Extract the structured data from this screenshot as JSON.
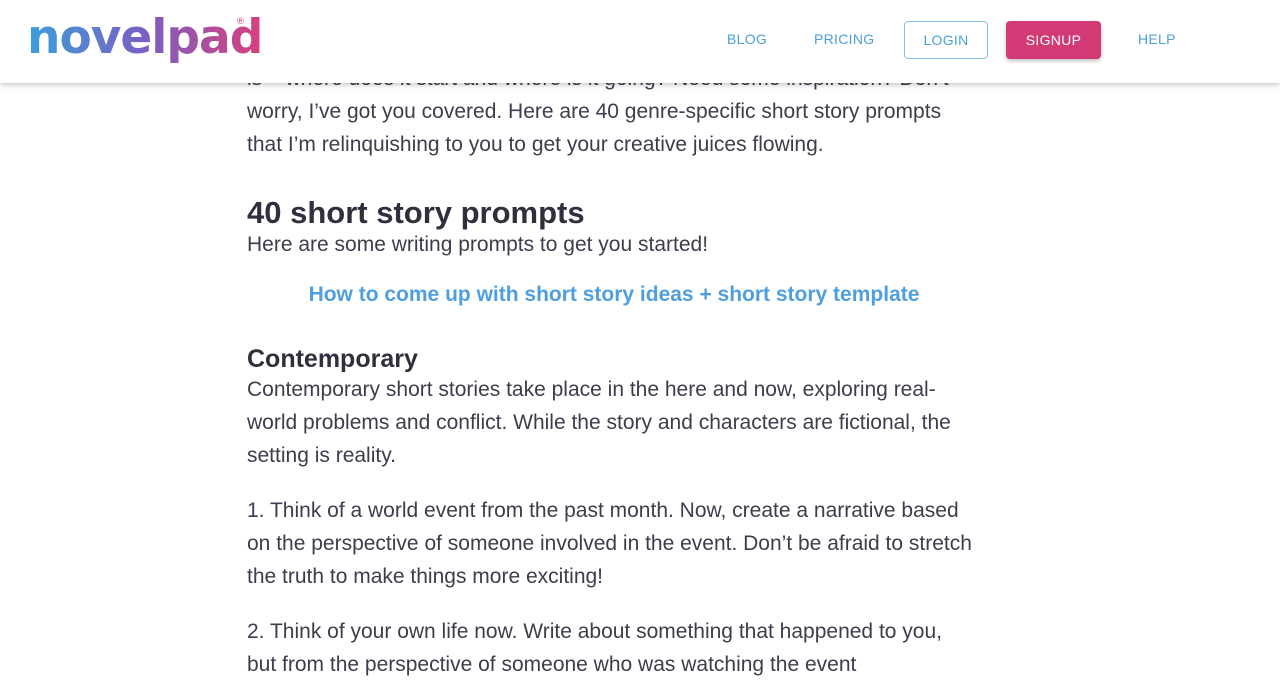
{
  "header": {
    "logo_text": "novelpad",
    "logo_mark": "®",
    "nav": {
      "blog": "BLOG",
      "pricing": "PRICING",
      "login": "LOGIN",
      "signup": "SIGNUP",
      "help": "HELP"
    },
    "colors": {
      "link": "#4a9fd8",
      "signup_bg": "#d23a76",
      "logo_gradient": [
        "#3aa0dc",
        "#7b5fc2",
        "#d8407c"
      ]
    }
  },
  "article": {
    "intro_partial_line": "is – where does it start and where is it going? Need some inspiration? Don’t",
    "intro_rest": "worry, I’ve got you covered. Here are 40 genre-specific short story prompts that I’m relinquishing to you to get your creative juices flowing.",
    "section_title": "40 short story prompts",
    "section_sub": "Here are some writing prompts to get you started!",
    "related_link": "How to come up with short story ideas + short story template",
    "genre_title": "Contemporary",
    "genre_desc": "Contemporary short stories take place in the here and now, exploring real-world problems and conflict. While the story and characters are fictional, the setting is reality.",
    "prompts": [
      "1. Think of a world event from the past month. Now, create a narrative based on the perspective of someone involved in the event. Don’t be afraid to stretch the truth to make things more exciting!",
      "2. Think of your own life now. Write about something that happened to you, but from the perspective of someone who was watching the event"
    ]
  }
}
